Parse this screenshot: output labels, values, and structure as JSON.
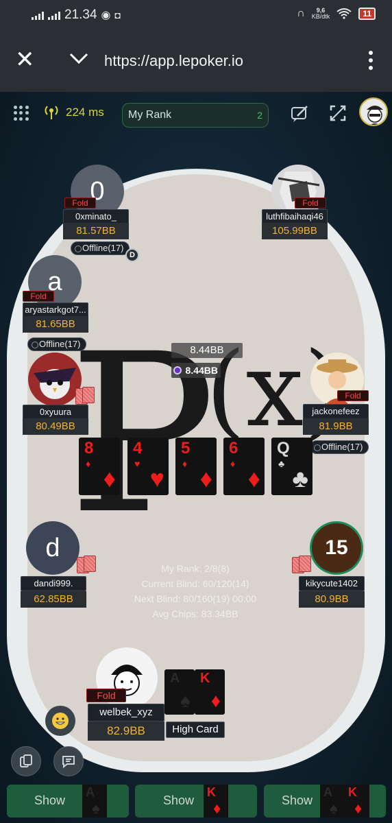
{
  "status_bar": {
    "time": "21.34",
    "net_speed": "9,6",
    "net_unit": "KB/dtk",
    "battery": "11"
  },
  "browser": {
    "url": "https://app.lepoker.io"
  },
  "top_bar": {
    "ping": "224 ms",
    "rank_label": "My Rank",
    "rank_value": "2"
  },
  "pot": {
    "total": "8.44BB",
    "current": "8.44BB"
  },
  "players": [
    {
      "avatar_letter": "0",
      "name": "0xminato_",
      "chips": "81.57BB",
      "status": "Fold",
      "offline": "Offline(17)"
    },
    {
      "name": "luthfibaihaqi46",
      "chips": "105.99BB",
      "status": "Fold"
    },
    {
      "avatar_letter": "a",
      "name": "aryastarkgot7...",
      "chips": "81.65BB",
      "status": "Fold",
      "offline": "Offline(17)"
    },
    {
      "name": "0xyuura",
      "chips": "80.49BB"
    },
    {
      "name": "jackonefeez",
      "chips": "81.9BB",
      "status": "Fold",
      "offline": "Offline(17)"
    },
    {
      "avatar_letter": "d",
      "name": "dandi999.",
      "chips": "62.85BB"
    },
    {
      "timer": "15",
      "name": "kikycute1402",
      "chips": "80.9BB"
    },
    {
      "name": "welbek_xyz",
      "chips": "82.9BB",
      "status": "Fold"
    }
  ],
  "dealer_label": "D",
  "board": [
    {
      "rank": "8",
      "suit": "♦",
      "color": "#ef1c1c"
    },
    {
      "rank": "4",
      "suit": "♥",
      "color": "#ef1c1c"
    },
    {
      "rank": "5",
      "suit": "♦",
      "color": "#ef1c1c"
    },
    {
      "rank": "6",
      "suit": "♦",
      "color": "#ef1c1c"
    },
    {
      "rank": "Q",
      "suit": "♣",
      "color": "#141414"
    }
  ],
  "hand": [
    {
      "rank": "A",
      "suit": "♠",
      "color": "#141414"
    },
    {
      "rank": "K",
      "suit": "♦",
      "color": "#ef1c1c"
    }
  ],
  "hand_label": "High Card",
  "table_info": {
    "rank": "My Rank: 2/8(8)",
    "current_blind": "Current Blind: 60/120(14)",
    "next_blind": "Next Blind: 80/160(19) 00:00",
    "avg_chips": "Avg Chips: 83.34BB"
  },
  "show_buttons": [
    {
      "label": "Show",
      "cards": [
        "A ♠"
      ]
    },
    {
      "label": "Show",
      "cards": [
        "K ♦"
      ]
    },
    {
      "label": "Show",
      "cards": [
        "A ♠",
        "K ♦"
      ]
    }
  ],
  "icons": [
    "wifi-icon",
    "ping-icon",
    "edit-icon",
    "expand-icon",
    "cards-icon",
    "chat-icon",
    "emoji-icon"
  ]
}
